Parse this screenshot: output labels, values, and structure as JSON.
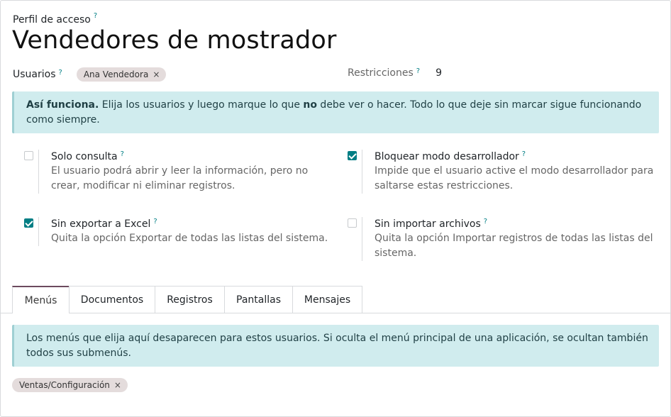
{
  "header": {
    "subtitle": "Perfil de acceso",
    "help_mark": "?",
    "title": "Vendedores de mostrador"
  },
  "fields": {
    "users_label": "Usuarios",
    "users": [
      "Ana Vendedora"
    ],
    "restrictions_label": "Restricciones",
    "restrictions_value": "9"
  },
  "intro_alert": {
    "bold_lead": "Así funciona.",
    "text_before": " Elija los usuarios y luego marque lo que ",
    "bold_word": "no",
    "text_after": " debe ver o hacer. Todo lo que deje sin marcar sigue funcionando como siempre."
  },
  "options": [
    {
      "title": "Solo consulta",
      "desc": "El usuario podrá abrir y leer la información, pero no crear, modificar ni eliminar registros.",
      "checked": false
    },
    {
      "title": "Bloquear modo desarrollador",
      "desc": "Impide que el usuario active el modo desarrollador para saltarse estas restricciones.",
      "checked": true
    },
    {
      "title": "Sin exportar a Excel",
      "desc": "Quita la opción Exportar de todas las listas del sistema.",
      "checked": true
    },
    {
      "title": "Sin importar archivos",
      "desc": "Quita la opción Importar registros de todas las listas del sistema.",
      "checked": false
    }
  ],
  "tabs": [
    {
      "label": "Menús",
      "active": true
    },
    {
      "label": "Documentos",
      "active": false
    },
    {
      "label": "Registros",
      "active": false
    },
    {
      "label": "Pantallas",
      "active": false
    },
    {
      "label": "Mensajes",
      "active": false
    }
  ],
  "menus_tab": {
    "info": "Los menús que elija aquí desaparecen para estos usuarios. Si oculta el menú principal de una aplicación, se ocultan también todos sus submenús.",
    "tags": [
      "Ventas/Configuración"
    ]
  },
  "colors": {
    "accent": "#017e84",
    "tab_active": "#6c4a5e",
    "alert_bg": "#d0ecee"
  },
  "icons": {
    "remove": "×"
  }
}
